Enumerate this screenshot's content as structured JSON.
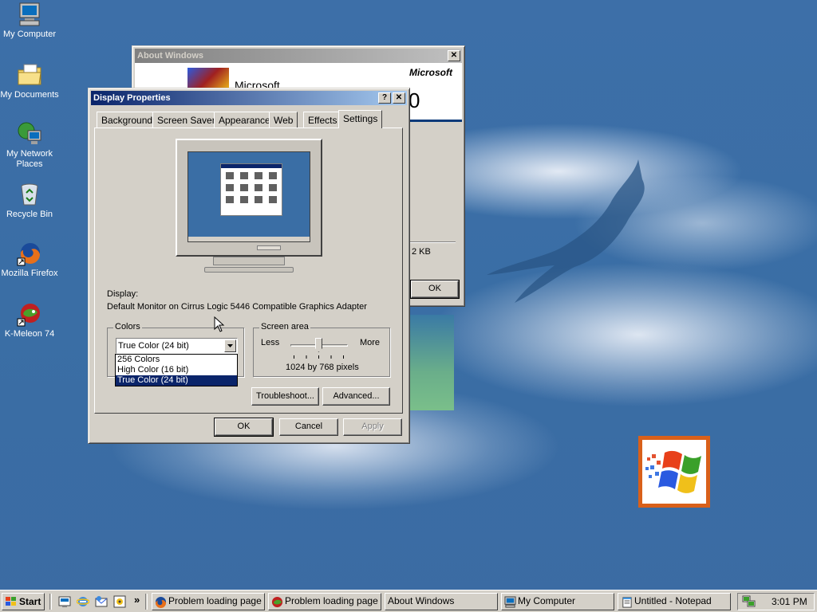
{
  "desktop": {
    "icons": [
      {
        "label": "My Computer",
        "icon": "computer-icon"
      },
      {
        "label": "My Documents",
        "icon": "folder-documents-icon"
      },
      {
        "label": "My Network Places",
        "icon": "network-places-icon"
      },
      {
        "label": "Recycle Bin",
        "icon": "recycle-bin-icon"
      },
      {
        "label": "Mozilla Firefox",
        "icon": "firefox-icon"
      },
      {
        "label": "K-Meleon 74",
        "icon": "kmeleon-icon"
      }
    ]
  },
  "about_window": {
    "title": "About Windows",
    "close_label": "✕",
    "brand_right": "Microsoft",
    "brand_left": "Microsoft",
    "version_fragment": "0",
    "memory_fragment": "2 KB",
    "ok_label": "OK"
  },
  "display_properties": {
    "title": "Display Properties",
    "help_label": "?",
    "close_label": "✕",
    "tabs": [
      "Background",
      "Screen Saver",
      "Appearance",
      "Web",
      "Effects",
      "Settings"
    ],
    "selected_tab": "Settings",
    "display_heading": "Display:",
    "display_device": "Default Monitor on Cirrus Logic 5446 Compatible Graphics Adapter",
    "colors": {
      "title": "Colors",
      "selected": "True Color (24 bit)",
      "options": [
        "256 Colors",
        "High Color (16 bit)",
        "True Color (24 bit)"
      ]
    },
    "screen_area": {
      "title": "Screen area",
      "less_label": "Less",
      "more_label": "More",
      "resolution": "1024 by 768 pixels",
      "slider_level": 0.5
    },
    "troubleshoot_label": "Troubleshoot...",
    "advanced_label": "Advanced...",
    "ok_label": "OK",
    "cancel_label": "Cancel",
    "apply_label": "Apply"
  },
  "taskbar": {
    "start_label": "Start",
    "quick_launch": [
      "show-desktop-icon",
      "ie-icon",
      "outlook-icon",
      "media-icon"
    ],
    "chevron": "»",
    "tasks": [
      {
        "label": "Problem loading page ...",
        "icon": "firefox-icon"
      },
      {
        "label": "Problem loading page ...",
        "icon": "kmeleon-icon"
      },
      {
        "label": "About Windows",
        "icon": ""
      },
      {
        "label": "My Computer",
        "icon": "computer-icon"
      },
      {
        "label": "Untitled - Notepad",
        "icon": "notepad-icon"
      }
    ],
    "clock": "3:01 PM"
  },
  "colors": {
    "desktop": "#3a6ea5",
    "title_active": "#0a246a",
    "face": "#d4d0c8",
    "selection": "#0a246a"
  }
}
